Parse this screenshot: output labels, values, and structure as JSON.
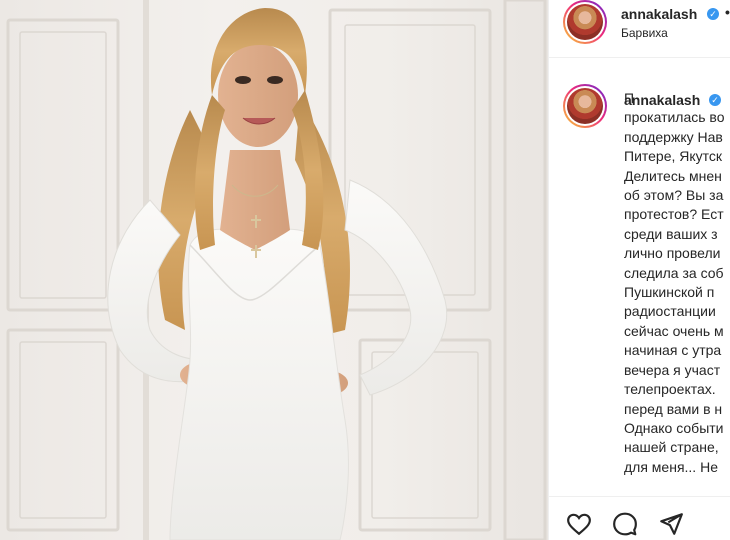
{
  "post": {
    "username": "annakalash",
    "verified": true,
    "location": "Барвиха",
    "menu_dot": "•"
  },
  "caption": {
    "username": "annakalash",
    "text": "П\nпрокатилась во\nподдержку Нав\nПитере, Якутск\nДелитесь мнен\nоб этом? Вы за\nпротестов? Ест\nсреди ваших з\nлично провели\nследила за соб\nПушкинской п\nрадиостанции\nсейчас очень м\nначиная с утра\nвечера я участ\nтелепроектах.\nперед вами в н\nОднако событи\nнашей стране,\nдля меня... Не"
  },
  "actions": {
    "like_icon": "heart-icon",
    "comment_icon": "comment-icon",
    "share_icon": "paper-plane-icon"
  },
  "photo": {
    "subject": "woman in white dress"
  }
}
